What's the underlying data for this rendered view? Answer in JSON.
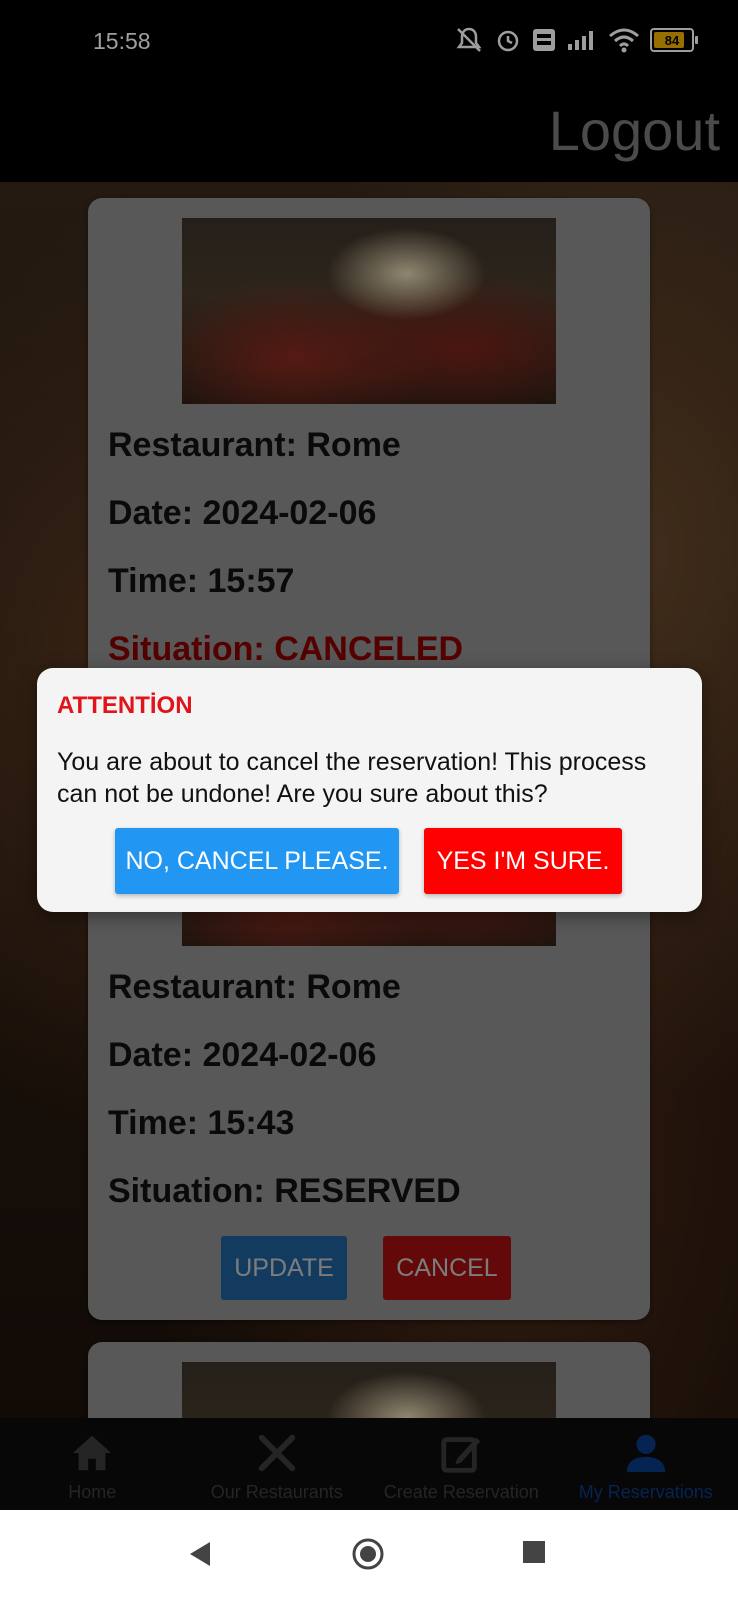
{
  "status_bar": {
    "time": "15:58",
    "battery": "84"
  },
  "header": {
    "logout_label": "Logout"
  },
  "cards": [
    {
      "restaurant": "Restaurant: Rome",
      "date": "Date: 2024-02-06",
      "time": "Time: 15:57",
      "situation": "Situation: CANCELED"
    },
    {
      "restaurant": "Restaurant: Rome",
      "date": "Date: 2024-02-06",
      "time": "Time: 15:43",
      "situation": "Situation: RESERVED",
      "update_label": "UPDATE",
      "cancel_label": "CANCEL"
    }
  ],
  "dialog": {
    "title": "ATTENTİON",
    "message": "You are about to cancel the reservation! This process can not be undone! Are you sure about this?",
    "no_label": "NO, CANCEL PLEASE.",
    "yes_label": "YES I'M SURE."
  },
  "bottom_nav": {
    "items": [
      {
        "label": "Home",
        "icon": "home-icon"
      },
      {
        "label": "Our Restaurants",
        "icon": "utensils-icon"
      },
      {
        "label": "Create Reservation",
        "icon": "edit-icon"
      },
      {
        "label": "My Reservations",
        "icon": "person-icon",
        "active": true
      }
    ]
  },
  "colors": {
    "accent_blue": "#2196f3",
    "danger_red": "#ff0000",
    "title_red": "#e0141a"
  }
}
